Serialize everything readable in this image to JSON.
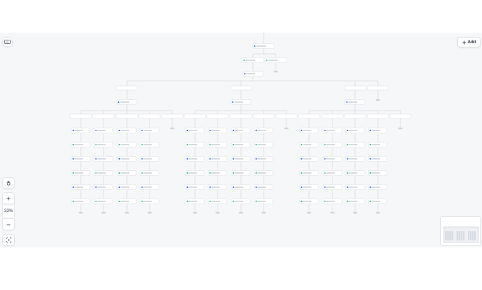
{
  "toolbar": {
    "add_label": "Add",
    "add_icon": "plus-icon",
    "keyboard_icon": "keyboard-icon"
  },
  "zoom": {
    "level": "33%",
    "zoom_in_icon": "plus-icon",
    "zoom_out_icon": "minus-icon",
    "fit_icon": "fit-view-icon",
    "pan_icon": "hand-icon"
  },
  "colors": {
    "canvas_bg": "#f6f7f9",
    "node_border": "#d9dde2",
    "edge": "#c4c9d0",
    "accent": "#2563eb",
    "green": "#22c55e",
    "pill": "#d1d5db"
  },
  "flow": {
    "branch_count": 3,
    "columns_per_branch": 4,
    "rows_per_column": 6
  }
}
